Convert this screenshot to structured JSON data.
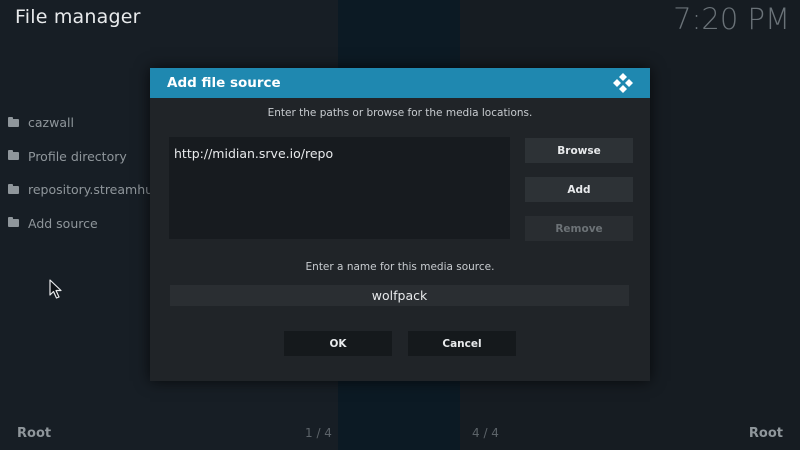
{
  "app": {
    "title": "File manager",
    "clock": "7:20 PM"
  },
  "sidebar": {
    "items": [
      {
        "label": "cazwall",
        "icon": "folder-icon"
      },
      {
        "label": "Profile directory",
        "icon": "folder-icon"
      },
      {
        "label": "repository.streamhub",
        "icon": "folder-icon"
      },
      {
        "label": "Add source",
        "icon": "folder-icon"
      }
    ]
  },
  "footer": {
    "left_root": "Root",
    "right_root": "Root",
    "left_page": "1 / 4",
    "right_page": "4 / 4"
  },
  "dialog": {
    "title": "Add file source",
    "logo_icon": "kodi-logo-icon",
    "header_color": "#1f88b0",
    "paths_instruction": "Enter the paths or browse for the media locations.",
    "paths": [
      "http://midian.srve.io/repo"
    ],
    "browse_label": "Browse",
    "add_label": "Add",
    "remove_label": "Remove",
    "name_instruction": "Enter a name for this media source.",
    "name_value": "wolfpack",
    "ok_label": "OK",
    "cancel_label": "Cancel"
  }
}
